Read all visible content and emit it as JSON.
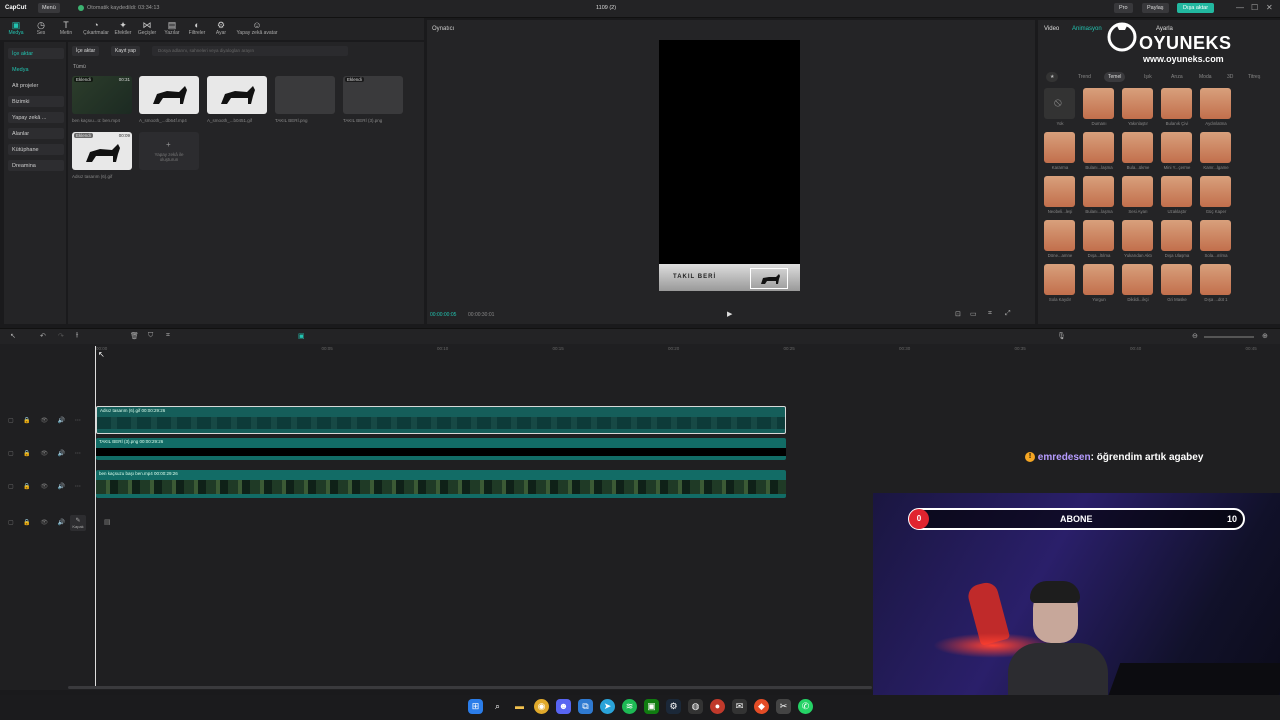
{
  "app": {
    "name": "CapCut",
    "menu": "Menü",
    "autosave": "Otomatik kaydedildi: 03:34:13",
    "project": "1109 (2)",
    "pro": "Pro",
    "share": "Paylaş",
    "export": "Dışa aktar"
  },
  "toolbar": [
    {
      "label": "Medya",
      "icon": "media-icon",
      "glyph": "▣"
    },
    {
      "label": "Ses",
      "icon": "audio-icon",
      "glyph": "◷"
    },
    {
      "label": "Metin",
      "icon": "text-icon",
      "glyph": "T"
    },
    {
      "label": "Çıkartmalar",
      "icon": "sticker-icon",
      "glyph": "◔"
    },
    {
      "label": "Efektler",
      "icon": "effects-icon",
      "glyph": "✦"
    },
    {
      "label": "Geçişler",
      "icon": "transition-icon",
      "glyph": "⋈"
    },
    {
      "label": "Yazılar",
      "icon": "caption-icon",
      "glyph": "▤"
    },
    {
      "label": "Filtreler",
      "icon": "filter-icon",
      "glyph": "◐"
    },
    {
      "label": "Ayar",
      "icon": "adjust-icon",
      "glyph": "⚙"
    },
    {
      "label": "Yapay zekâ avatar",
      "icon": "ai-avatar-icon",
      "glyph": "☺"
    }
  ],
  "leftnav": [
    "İçe aktar",
    "Medya",
    "Alt projeler",
    "Bizimki",
    "Yapay zekâ ...",
    "Alanlar",
    "Kütüphane",
    "Dreamina"
  ],
  "media": {
    "import": "İçe aktar",
    "record": "Kayıt yap",
    "search": "Dosya adlarını, sahneleri veya diyalogları arayın",
    "filter_all": "Tümü",
    "items": [
      {
        "name": "ben kaçsıu...ü: ben.mp4",
        "badge": "Eklendi",
        "dur": "00:31"
      },
      {
        "name": "A_smooth_...db64f.mp4",
        "badge": "",
        "dur": ""
      },
      {
        "name": "A_smooth_...b0451.gif",
        "badge": "",
        "dur": ""
      },
      {
        "name": "TAKIL BERİ.png",
        "badge": "",
        "dur": ""
      },
      {
        "name": "TAKIL BERİ (3).png",
        "badge": "Eklendi",
        "dur": ""
      },
      {
        "name": "Adsız tasarım (6).gif",
        "badge": "Eklendi",
        "dur": "00:09"
      }
    ],
    "ai_placeholder": "Yapay zekâ ile oluşturun"
  },
  "player": {
    "title": "Oynatıcı",
    "time_current": "00:00:00:05",
    "time_total": "00:00:30:01",
    "overlay_text": "TAKIL BERİ"
  },
  "right": {
    "tabs": [
      "Video",
      "Animasyon",
      "Hız",
      "Ayarla"
    ],
    "filters": [
      "★",
      "Trend",
      "Temel",
      "Işık",
      "Arıza",
      "Moda",
      "3D",
      "Titreş"
    ],
    "effects": [
      "Yok",
      "Dumanı",
      "Yakınlaştır",
      "Bulanık Çivi",
      "Aydınlatma",
      "Kararma",
      "Bulanı...laşma",
      "Bula...ükme",
      "Mini Y...çerme",
      "Kamr...lgame",
      "Neobeli...leşi",
      "Bulanı...laşma",
      "Sesi Ayarı",
      "Uzaklaştır",
      "Güç Kaper",
      "Döne...amne",
      "Dışa...ltılma",
      "Yukarıdan Aktı",
      "Dışa Ulaşma",
      "Sola...ırılma",
      "Sola Kaydır",
      "Yorgun",
      "Dikildi...ikçi",
      "Gri Maske",
      "Dışa ...düt 1"
    ]
  },
  "timeline": {
    "ruler": [
      "00:00",
      "00:05",
      "00:10",
      "00:15",
      "00:20",
      "00:25",
      "00:30",
      "00:35",
      "00:40",
      "00:45",
      "00:50"
    ],
    "clips": [
      {
        "label": "Adsız tasarım (6).gif  00:00:29:26"
      },
      {
        "label": "TAKIL BERİ (3).png  00:00:29:26"
      },
      {
        "label": "ben kaçsuzu başı ben.mp4  00:00:29:26"
      }
    ],
    "cover": "Kapak"
  },
  "stream": {
    "chat_user": "emredesen",
    "chat_text": ": öğrendim artık agabey",
    "sub_label": "ABONE",
    "sub_current": "0",
    "sub_goal": "10",
    "logo": "OYUNEKS",
    "logo_url": "www.oyuneks.com"
  },
  "taskbar": [
    "windows-icon",
    "search-icon",
    "folder-icon",
    "chrome-icon",
    "discord-icon",
    "vscode-icon",
    "telegram-icon",
    "spotify-icon",
    "xbox-icon",
    "steam-icon",
    "obs-icon",
    "app-icon",
    "brave-icon",
    "capcut-icon",
    "whatsapp-icon"
  ]
}
